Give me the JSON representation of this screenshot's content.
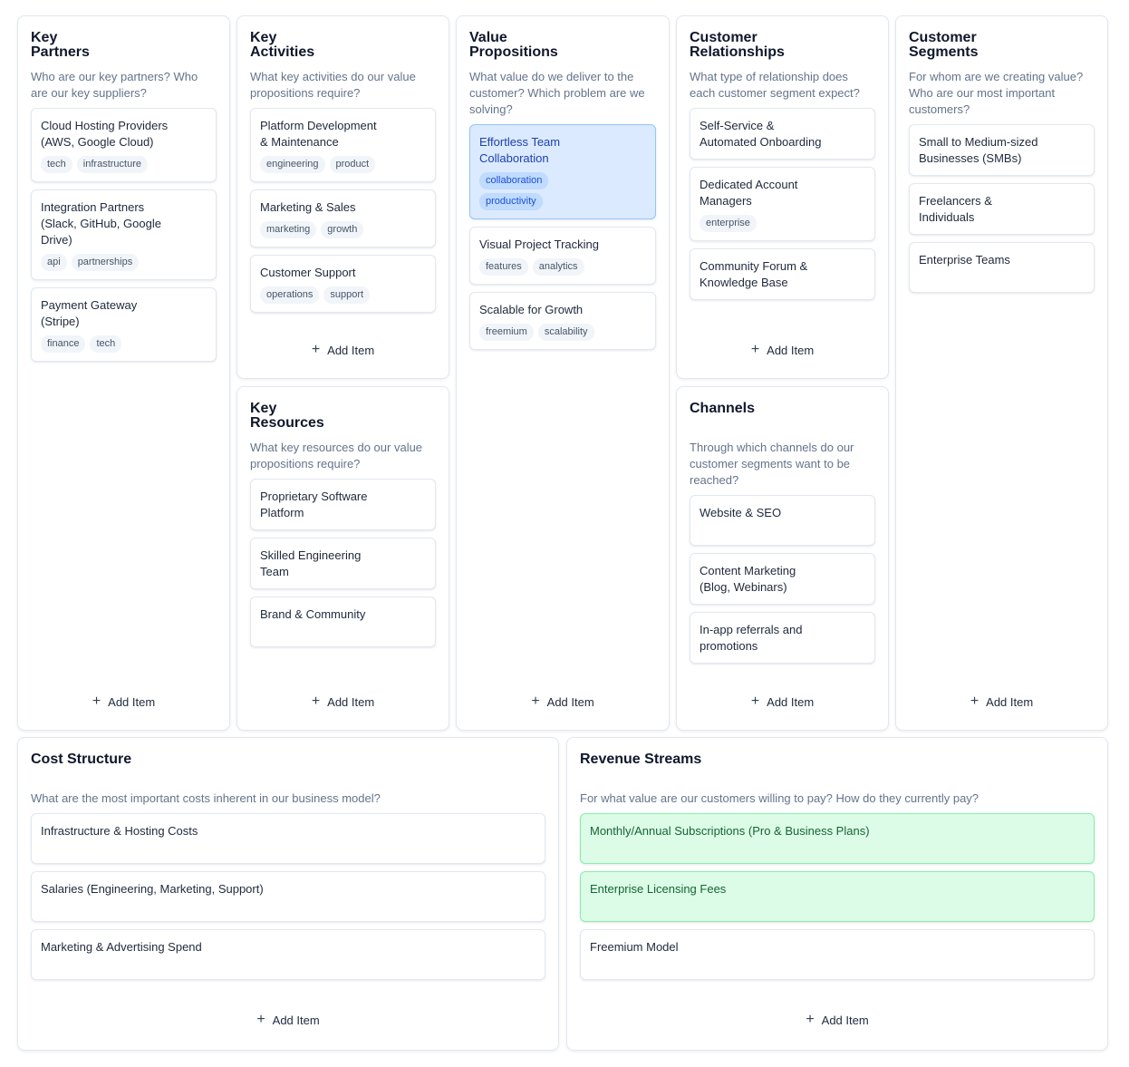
{
  "add_label": "Add Item",
  "plus_glyph": "+",
  "colors": {
    "border": "#e2e8f0",
    "desc": "#64748b",
    "blue_card": "#dbeafe",
    "green_card": "#dcfce7"
  },
  "key_partners": {
    "title": "Key\nPartners",
    "description": "Who are our key partners? Who are our key suppliers?",
    "items": [
      {
        "text": "Cloud Hosting Providers\n(AWS, Google Cloud)",
        "tags": [
          "tech",
          "infrastructure"
        ]
      },
      {
        "text": "Integration Partners\n(Slack, GitHub, Google\nDrive)",
        "tags": [
          "api",
          "partnerships"
        ]
      },
      {
        "text": "Payment Gateway\n(Stripe)",
        "tags": [
          "finance",
          "tech"
        ]
      }
    ]
  },
  "key_activities": {
    "title": "Key\nActivities",
    "description": "What key activities do our value propositions require?",
    "items": [
      {
        "text": "Platform Development\n& Maintenance",
        "tags": [
          "engineering",
          "product"
        ]
      },
      {
        "text": "Marketing & Sales",
        "tags": [
          "marketing",
          "growth"
        ]
      },
      {
        "text": "Customer Support",
        "tags": [
          "operations",
          "support"
        ]
      }
    ]
  },
  "key_resources": {
    "title": "Key\nResources",
    "description": "What key resources do our value propositions require?",
    "items": [
      {
        "text": "Proprietary Software\nPlatform"
      },
      {
        "text": "Skilled Engineering\nTeam"
      },
      {
        "text": "Brand & Community"
      }
    ]
  },
  "value_propositions": {
    "title": "Value\nPropositions",
    "description": "What value do we deliver to the customer? Which problem are we solving?",
    "items": [
      {
        "text": "Effortless Team\nCollaboration",
        "tags": [
          "collaboration",
          "productivity"
        ]
      },
      {
        "text": "Visual Project Tracking",
        "tags": [
          "features",
          "analytics"
        ]
      },
      {
        "text": "Scalable for Growth",
        "tags": [
          "freemium",
          "scalability"
        ]
      }
    ]
  },
  "customer_relationships": {
    "title": "Customer\nRelationships",
    "description": "What type of relationship does each customer segment expect?",
    "items": [
      {
        "text": "Self-Service &\nAutomated Onboarding"
      },
      {
        "text": "Dedicated Account\nManagers",
        "tags": [
          "enterprise"
        ]
      },
      {
        "text": "Community Forum &\nKnowledge Base"
      }
    ]
  },
  "channels": {
    "title": "Channels",
    "description": "Through which channels do our customer segments want to be reached?",
    "items": [
      {
        "text": "Website & SEO"
      },
      {
        "text": "Content Marketing\n(Blog, Webinars)"
      },
      {
        "text": "In-app referrals and\npromotions"
      }
    ]
  },
  "customer_segments": {
    "title": "Customer\nSegments",
    "description": "For whom are we creating value? Who are our most important customers?",
    "items": [
      {
        "text": "Small to Medium-sized\nBusinesses (SMBs)"
      },
      {
        "text": "Freelancers &\nIndividuals"
      },
      {
        "text": "Enterprise Teams"
      }
    ]
  },
  "cost_structure": {
    "title": "Cost Structure",
    "description": "What are the most important costs inherent in our business model?",
    "items": [
      {
        "text": "Infrastructure & Hosting Costs"
      },
      {
        "text": "Salaries (Engineering, Marketing, Support)"
      },
      {
        "text": "Marketing & Advertising Spend"
      }
    ]
  },
  "revenue_streams": {
    "title": "Revenue Streams",
    "description": "For what value are our customers willing to pay? How do they currently pay?",
    "items": [
      {
        "text": "Monthly/Annual Subscriptions (Pro & Business Plans)"
      },
      {
        "text": "Enterprise Licensing Fees"
      },
      {
        "text": "Freemium Model"
      }
    ]
  }
}
